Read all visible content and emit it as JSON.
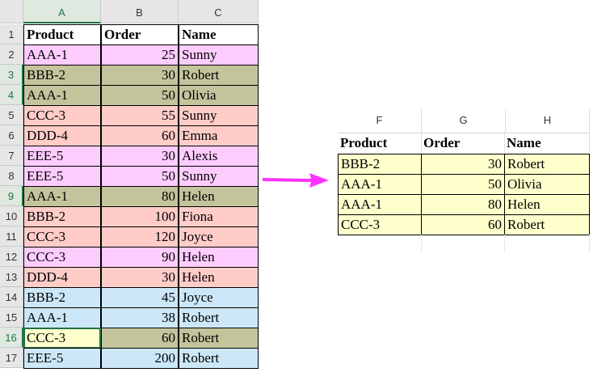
{
  "left_sheet": {
    "columns": [
      "A",
      "B",
      "C"
    ],
    "header_row": {
      "row": "1",
      "cells": [
        "Product",
        "Order",
        "Name"
      ]
    },
    "rows": [
      {
        "row": "2",
        "cells": [
          "AAA-1",
          "25",
          "Sunny"
        ],
        "fill": "#ffccff"
      },
      {
        "row": "3",
        "cells": [
          "BBB-2",
          "30",
          "Robert"
        ],
        "fill": "#c4c49c"
      },
      {
        "row": "4",
        "cells": [
          "AAA-1",
          "50",
          "Olivia"
        ],
        "fill": "#c4c49c"
      },
      {
        "row": "5",
        "cells": [
          "CCC-3",
          "55",
          "Sunny"
        ],
        "fill": "#ffccc8"
      },
      {
        "row": "6",
        "cells": [
          "DDD-4",
          "60",
          "Emma"
        ],
        "fill": "#ffccc8"
      },
      {
        "row": "7",
        "cells": [
          "EEE-5",
          "30",
          "Alexis"
        ],
        "fill": "#ffccff"
      },
      {
        "row": "8",
        "cells": [
          "EEE-5",
          "50",
          "Sunny"
        ],
        "fill": "#ffccff"
      },
      {
        "row": "9",
        "cells": [
          "AAA-1",
          "80",
          "Helen"
        ],
        "fill": "#c4c49c"
      },
      {
        "row": "10",
        "cells": [
          "BBB-2",
          "100",
          "Fiona"
        ],
        "fill": "#ffccc8"
      },
      {
        "row": "11",
        "cells": [
          "CCC-3",
          "120",
          "Joyce"
        ],
        "fill": "#ffccc8"
      },
      {
        "row": "12",
        "cells": [
          "CCC-3",
          "90",
          "Helen"
        ],
        "fill": "#ffccff"
      },
      {
        "row": "13",
        "cells": [
          "DDD-4",
          "30",
          "Helen"
        ],
        "fill": "#ffccc8"
      },
      {
        "row": "14",
        "cells": [
          "BBB-2",
          "45",
          "Joyce"
        ],
        "fill": "#cce8f8"
      },
      {
        "row": "15",
        "cells": [
          "AAA-1",
          "38",
          "Robert"
        ],
        "fill": "#cce8f8"
      },
      {
        "row": "16",
        "cells": [
          "CCC-3",
          "60",
          "Robert"
        ],
        "fill": "#c4c49c"
      },
      {
        "row": "17",
        "cells": [
          "EEE-5",
          "200",
          "Robert"
        ],
        "fill": "#cce8f8"
      }
    ],
    "highlighted_rows": [
      "3",
      "4",
      "9",
      "16"
    ],
    "selected_cell": "A16",
    "selected_fill": "#ffffcc"
  },
  "right_sheet": {
    "columns": [
      "F",
      "G",
      "H"
    ],
    "header_row": {
      "cells": [
        "Product",
        "Order",
        "Name"
      ]
    },
    "rows": [
      {
        "cells": [
          "BBB-2",
          "30",
          "Robert"
        ]
      },
      {
        "cells": [
          "AAA-1",
          "50",
          "Olivia"
        ]
      },
      {
        "cells": [
          "AAA-1",
          "80",
          "Helen"
        ]
      },
      {
        "cells": [
          "CCC-3",
          "60",
          "Robert"
        ]
      }
    ],
    "fill": "#ffffcc"
  },
  "arrow_color": "#ff33ff"
}
